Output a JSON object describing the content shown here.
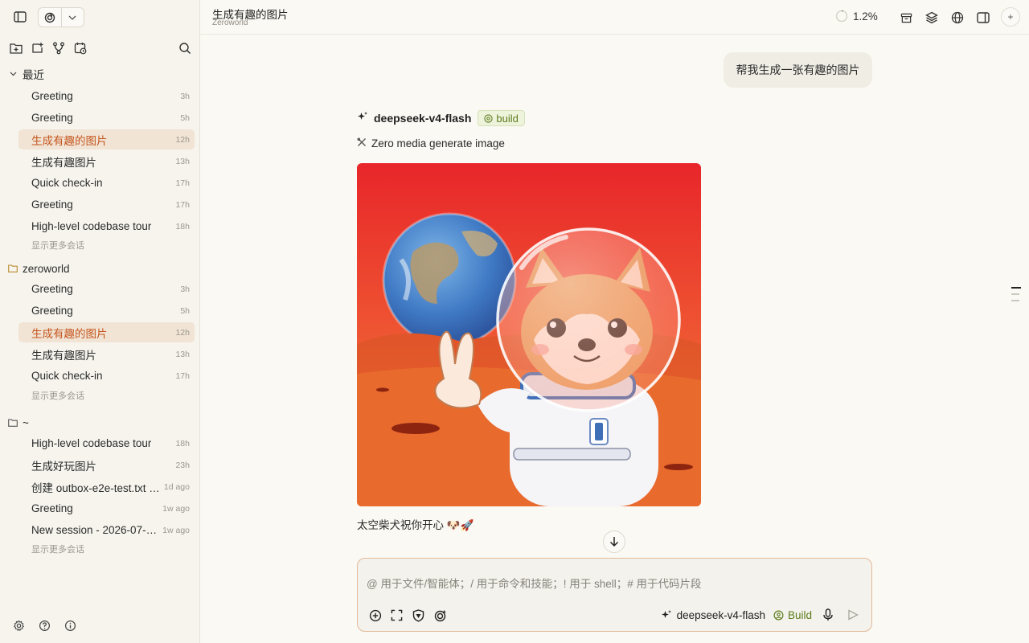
{
  "sidebar": {
    "groups": [
      {
        "name": "最近",
        "items": [
          {
            "label": "Greeting",
            "time": "3h"
          },
          {
            "label": "Greeting",
            "time": "5h"
          },
          {
            "label": "生成有趣的图片",
            "time": "12h"
          },
          {
            "label": "生成有趣图片",
            "time": "13h"
          },
          {
            "label": "Quick check-in",
            "time": "17h"
          },
          {
            "label": "Greeting",
            "time": "17h"
          },
          {
            "label": "High-level codebase tour",
            "time": "18h"
          }
        ],
        "more": "显示更多会话"
      },
      {
        "name": "zeroworld",
        "items": [
          {
            "label": "Greeting",
            "time": "3h"
          },
          {
            "label": "Greeting",
            "time": "5h"
          },
          {
            "label": "生成有趣的图片",
            "time": "12h"
          },
          {
            "label": "生成有趣图片",
            "time": "13h"
          },
          {
            "label": "Quick check-in",
            "time": "17h"
          }
        ],
        "more": "显示更多会话"
      },
      {
        "name": "~",
        "items": [
          {
            "label": "High-level codebase tour",
            "time": "18h"
          },
          {
            "label": "生成好玩图片",
            "time": "23h"
          },
          {
            "label": "创建 outbox-e2e-test.txt …",
            "time": "1d ago"
          },
          {
            "label": "Greeting",
            "time": "1w ago"
          },
          {
            "label": "New session - 2026-07-1…",
            "time": "1w ago"
          }
        ],
        "more": "显示更多会话"
      }
    ]
  },
  "header": {
    "title": "生成有趣的图片",
    "subtitle": "Zeroworld",
    "usage": "1.2%",
    "usage_fraction": 0.012
  },
  "chat": {
    "user_message": "帮我生成一张有趣的图片",
    "agent_name": "deepseek-v4-flash",
    "agent_mode": "build",
    "tool_label": "Zero media generate image",
    "caption": "太空柴犬祝你开心 🐶🚀"
  },
  "composer": {
    "placeholder": "@ 用于文件/智能体；/ 用于命令和技能；! 用于 shell；# 用于代码片段",
    "model": "deepseek-v4-flash",
    "mode": "Build"
  },
  "colors": {
    "accent": "#c4551e",
    "active_bg": "#f1e4d4",
    "build_green": "#5c7c1c",
    "background": "#fbf9f3"
  }
}
